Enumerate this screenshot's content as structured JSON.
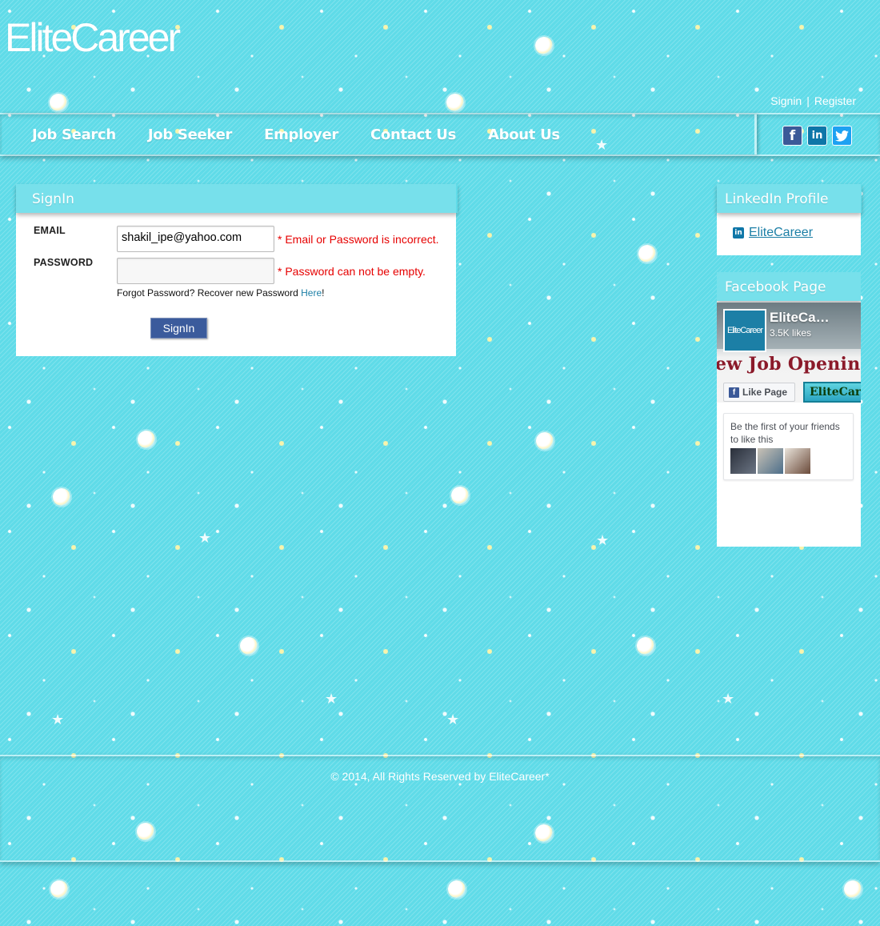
{
  "header": {
    "logo": "EliteCareer",
    "signin_link": "Signin",
    "separator": "|",
    "register_link": "Register"
  },
  "nav": {
    "items": [
      {
        "label": "Job Search"
      },
      {
        "label": "Job Seeker"
      },
      {
        "label": "Employer"
      },
      {
        "label": "Contact Us"
      },
      {
        "label": "About Us"
      }
    ],
    "social_icons": [
      "facebook-icon",
      "linkedin-icon",
      "twitter-icon"
    ]
  },
  "signin": {
    "title": "SignIn",
    "email_label": "EMAIL",
    "email_value": "shakil_ipe@yahoo.com",
    "email_error": "* Email or Password is incorrect.",
    "password_label": "PASSWORD",
    "password_value": "",
    "password_error": "* Password can not be empty.",
    "forgot_text": "Forgot Password? Recover new Password ",
    "forgot_link": "Here",
    "forgot_suffix": "!",
    "button_label": "SignIn"
  },
  "linkedin": {
    "title": "LinkedIn Profile",
    "link_text": "EliteCareer"
  },
  "facebook": {
    "title": "Facebook Page",
    "page_name": "EliteCa…",
    "likes": "3.5K likes",
    "thumb_text": "EliteCareer",
    "banner_text": "ew Job Openin",
    "like_button": "Like Page",
    "brand_strip": "EliteCare",
    "friends_text": "Be the first of your friends to like this"
  },
  "footer": {
    "copyright": "© 2014, All Rights Reserved by EliteCareer*"
  },
  "colors": {
    "background": "#5fdbe8",
    "error": "#e60000",
    "link": "#1c7fa6",
    "button": "#3b5b9c"
  }
}
